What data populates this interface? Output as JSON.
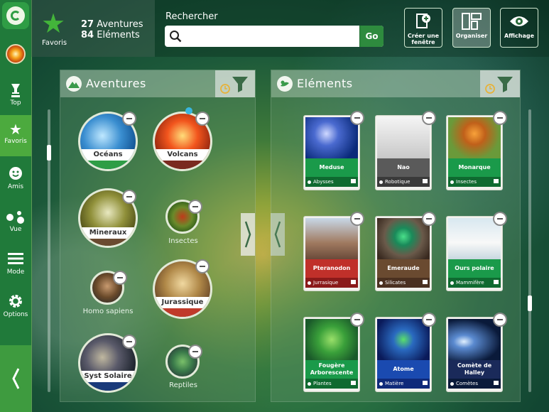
{
  "sidebar": {
    "items": [
      {
        "label": "Top",
        "icon": "trophy-icon"
      },
      {
        "label": "Favoris",
        "icon": "star-icon"
      },
      {
        "label": "Amis",
        "icon": "smiley-icon"
      },
      {
        "label": "Vue",
        "icon": "dots-icon"
      },
      {
        "label": "Mode",
        "icon": "menu-icon"
      },
      {
        "label": "Options",
        "icon": "gear-icon"
      }
    ],
    "active": "Favoris"
  },
  "header": {
    "favorites_label": "Favoris",
    "adventures_count": "27",
    "adventures_label": "Aventures",
    "elements_count": "84",
    "elements_label": "Eléments",
    "search_label": "Rechercher",
    "search_value": "",
    "go_label": "Go",
    "buttons": [
      "Créer une fenêtre",
      "Organiser",
      "Affichage"
    ]
  },
  "adventures_panel": {
    "title": "Aventures",
    "items": [
      {
        "label": "Océans"
      },
      {
        "label": "Volcans"
      },
      {
        "label": "Mineraux"
      },
      {
        "label": "Insectes"
      },
      {
        "label": "Homo sapiens"
      },
      {
        "label": "Jurassique"
      },
      {
        "label": "Syst Solaire"
      },
      {
        "label": "Reptiles"
      }
    ]
  },
  "elements_panel": {
    "title": "Eléments",
    "items": [
      {
        "name": "Meduse",
        "category": "Abysses"
      },
      {
        "name": "Nao",
        "category": "Robotique"
      },
      {
        "name": "Monarque",
        "category": "Insectes"
      },
      {
        "name": "Pteranodon",
        "category": "Jurrasique"
      },
      {
        "name": "Emeraude",
        "category": "Silicates"
      },
      {
        "name": "Ours polaire",
        "category": "Mammifère"
      },
      {
        "name": "Fougère Arborescente",
        "category": "Plantes"
      },
      {
        "name": "Atome",
        "category": "Matière"
      },
      {
        "name": "Comète de Halley",
        "category": "Comètes"
      }
    ]
  },
  "colors": {
    "accent": "#4caa3e",
    "sidebar": "#207a3a"
  }
}
